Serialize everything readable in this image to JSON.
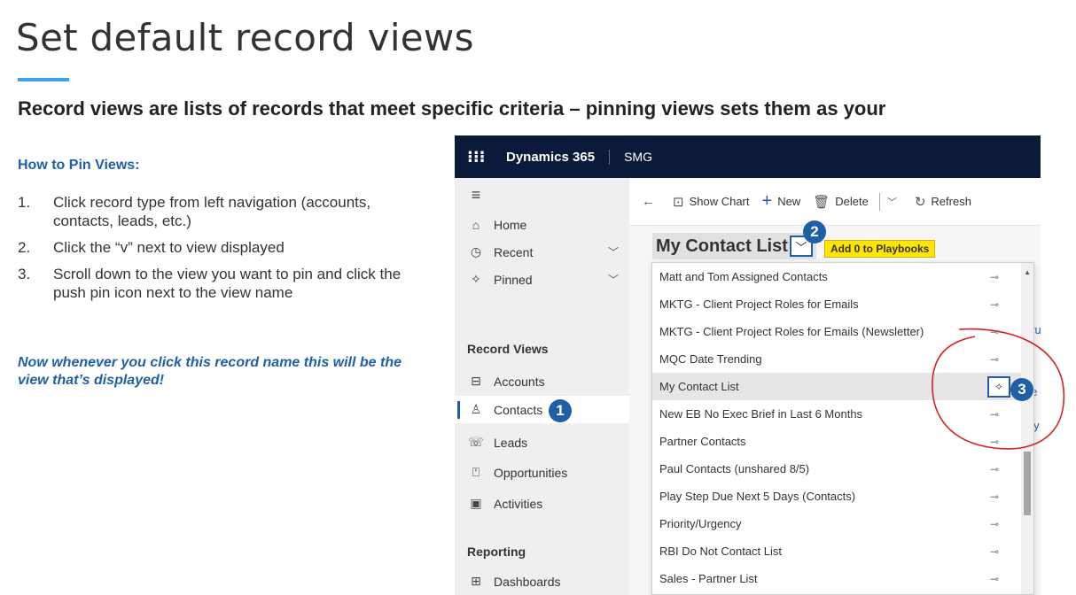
{
  "slide": {
    "title": "Set default record views",
    "headline": "Record views are lists of records that meet specific criteria – pinning views sets them as your",
    "howto_heading": "How to Pin Views:",
    "steps": [
      {
        "num": "1.",
        "text": "Click record type from left navigation (accounts, contacts, leads, etc.)"
      },
      {
        "num": "2.",
        "text": "Click the “v” next to view displayed"
      },
      {
        "num": "3.",
        "text": "Scroll down to the view you want to pin and click the push pin icon next to the view name"
      }
    ],
    "callout": "Now whenever you click this record name this will be the view that’s displayed!"
  },
  "app": {
    "waffle_icon": "⁝⁝⁝",
    "brand": "Dynamics 365",
    "org": "SMG",
    "nav": {
      "hamburger": "≡",
      "home": "Home",
      "recent": "Recent",
      "pinned": "Pinned",
      "section_record_views": "Record Views",
      "accounts": "Accounts",
      "contacts": "Contacts",
      "leads": "Leads",
      "opportunities": "Opportunities",
      "activities": "Activities",
      "section_reporting": "Reporting",
      "dashboards": "Dashboards"
    },
    "commands": {
      "back": "←",
      "show_chart": "Show Chart",
      "new": "New",
      "delete": "Delete",
      "refresh": "Refresh"
    },
    "view": {
      "title": "My Contact List",
      "add_button": "Add 0 to Playbooks"
    },
    "views_list": [
      "Matt and Tom Assigned Contacts",
      "MKTG - Client Project Roles for Emails",
      "MKTG - Client Project Roles for Emails (Newsletter)",
      "MQC Date Trending",
      "My Contact List",
      "New EB No Exec Brief in Last 6 Months",
      "Partner Contacts",
      "Paul Contacts (unshared 8/5)",
      "Play Step Due Next 5 Days (Contacts)",
      "Priority/Urgency",
      "RBI Do Not Contact List",
      "Sales - Partner List"
    ],
    "peek_text": [
      "hru",
      "rt",
      "be",
      "ley"
    ],
    "badges": [
      "1",
      "2",
      "3"
    ]
  },
  "colors": {
    "accent_blue": "#1f5fa8",
    "topbar": "#0b1a3a",
    "highlight_yellow": "#ffe500",
    "annotation_red": "#d62020",
    "title_rule": "#3ba3e8"
  }
}
